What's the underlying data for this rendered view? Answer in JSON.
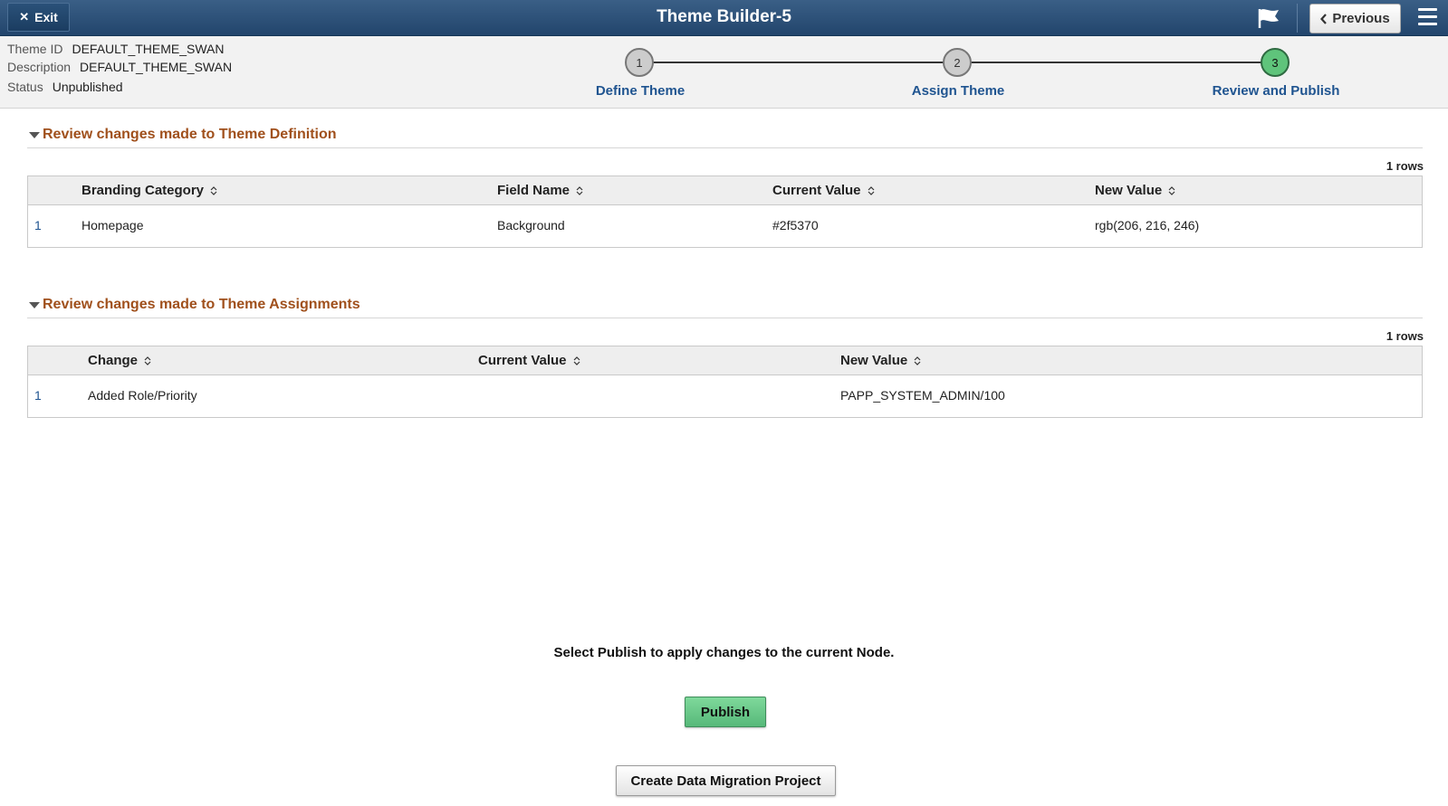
{
  "header": {
    "exit_label": "Exit",
    "title": "Theme Builder-5",
    "previous_label": "Previous",
    "flag_icon": "flag-icon",
    "menu_icon": "hamburger-menu-icon",
    "colors": {
      "bar": "#2e527a"
    }
  },
  "info": {
    "theme_id_label": "Theme ID",
    "theme_id_value": "DEFAULT_THEME_SWAN",
    "description_label": "Description",
    "description_value": "DEFAULT_THEME_SWAN",
    "status_label": "Status",
    "status_value": "Unpublished"
  },
  "train": {
    "steps": [
      {
        "number": "1",
        "label": "Define Theme",
        "state": "complete"
      },
      {
        "number": "2",
        "label": "Assign Theme",
        "state": "complete"
      },
      {
        "number": "3",
        "label": "Review and Publish",
        "state": "current"
      }
    ],
    "active_color": "#5fc47b"
  },
  "definition_section": {
    "title": "Review changes made to Theme Definition",
    "row_count": "1 rows",
    "columns": [
      "Branding Category",
      "Field Name",
      "Current Value",
      "New Value"
    ],
    "rows": [
      {
        "num": "1",
        "cells": [
          "Homepage",
          "Background",
          "#2f5370",
          "rgb(206, 216, 246)"
        ]
      }
    ]
  },
  "assignments_section": {
    "title": "Review changes made to Theme Assignments",
    "row_count": "1 rows",
    "columns": [
      "Change",
      "Current Value",
      "New Value"
    ],
    "rows": [
      {
        "num": "1",
        "cells": [
          "Added Role/Priority",
          "",
          "PAPP_SYSTEM_ADMIN/100"
        ]
      }
    ]
  },
  "footer": {
    "publish_message": "Select Publish to apply changes to the current Node.",
    "publish_label": "Publish",
    "migration_label": "Create Data Migration Project",
    "publish_color": "#66c486"
  }
}
